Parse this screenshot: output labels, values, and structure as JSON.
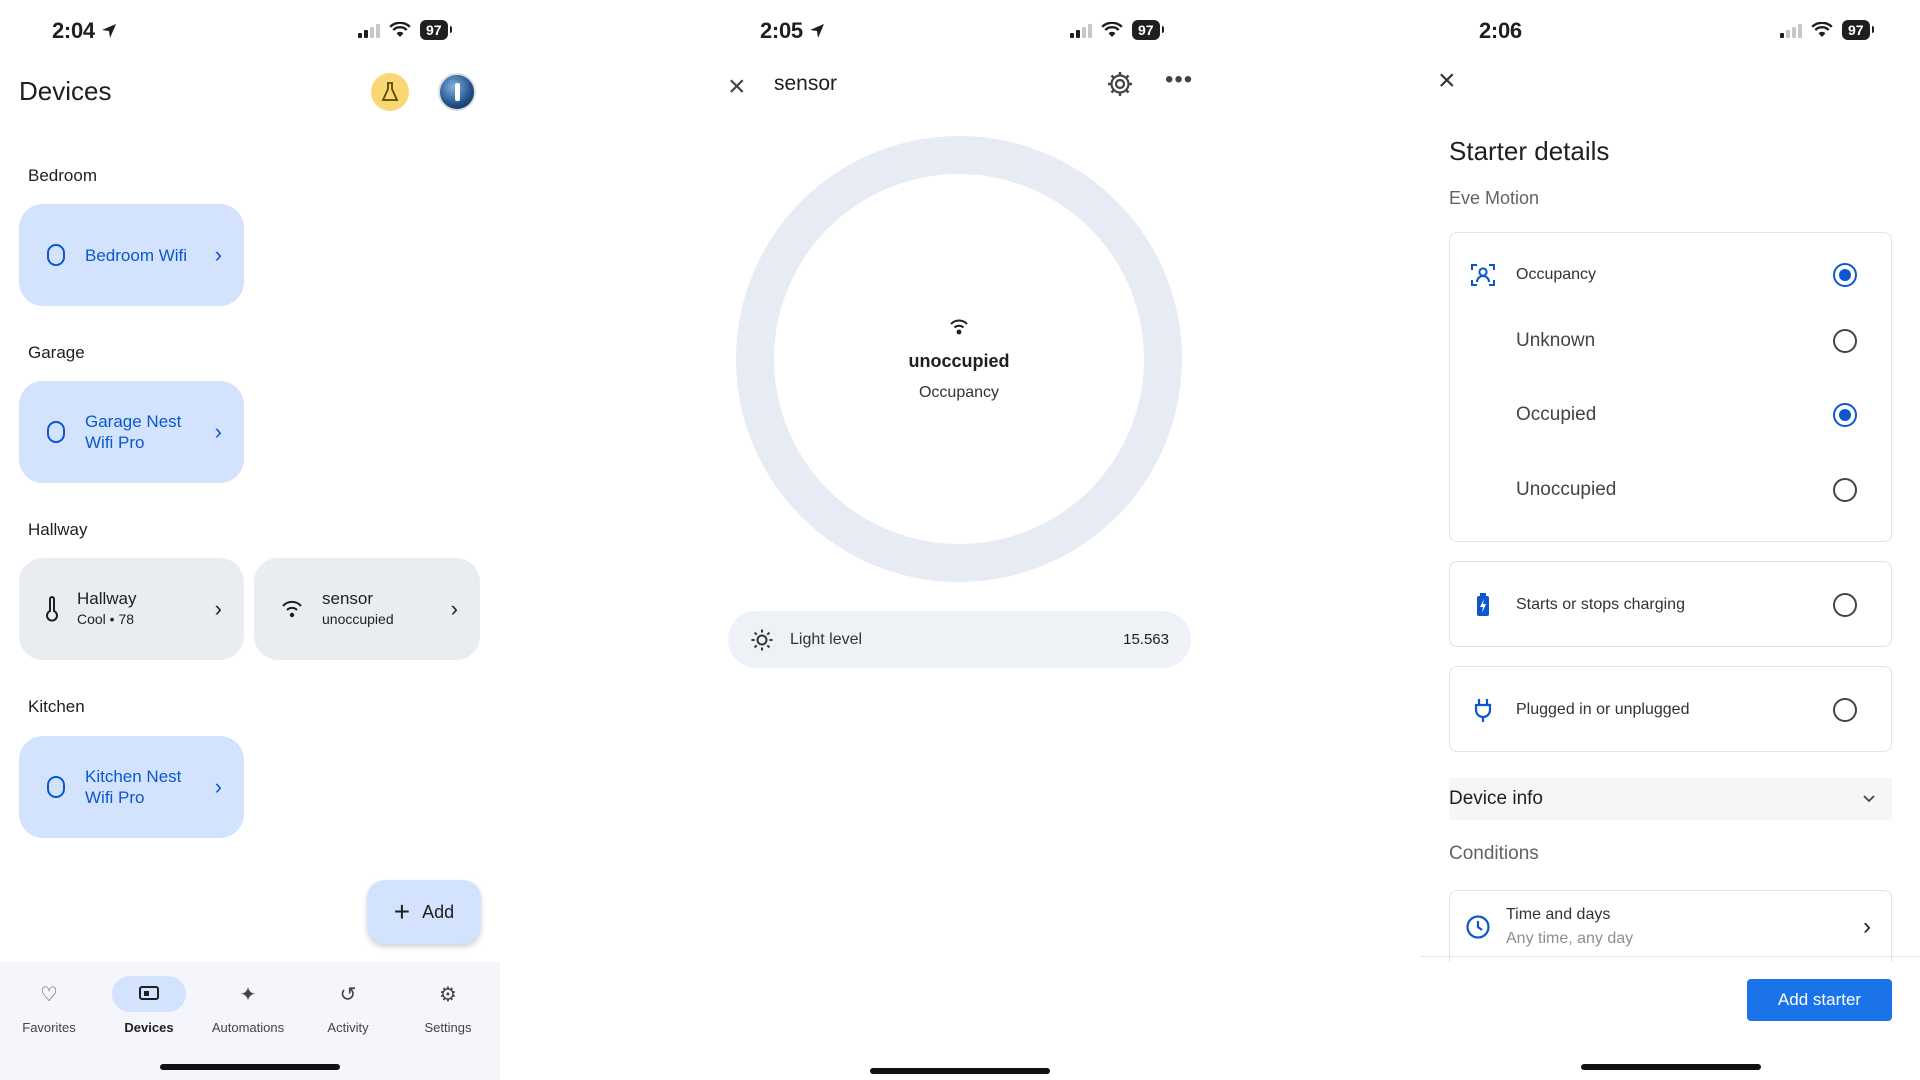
{
  "panel1": {
    "status": {
      "time": "2:04",
      "battery": "97"
    },
    "title": "Devices",
    "rooms": [
      {
        "name": "Bedroom"
      },
      {
        "name": "Garage"
      },
      {
        "name": "Hallway"
      },
      {
        "name": "Kitchen"
      }
    ],
    "tiles": {
      "bedroom_wifi": {
        "line1": "Bedroom Wifi",
        "line2": ""
      },
      "garage_wifi": {
        "line1": "Garage Nest",
        "line2": "Wifi Pro"
      },
      "hallway": {
        "line1": "Hallway",
        "line2": "Cool • 78"
      },
      "sensor": {
        "line1": "sensor",
        "line2": "unoccupied"
      },
      "kitchen_wifi": {
        "line1": "Kitchen Nest",
        "line2": "Wifi Pro"
      }
    },
    "fab_label": "Add",
    "nav": [
      {
        "label": "Favorites",
        "icon": "heart-icon"
      },
      {
        "label": "Devices",
        "icon": "devices-icon"
      },
      {
        "label": "Automations",
        "icon": "sparkle-icon"
      },
      {
        "label": "Activity",
        "icon": "history-icon"
      },
      {
        "label": "Settings",
        "icon": "gear-icon"
      }
    ],
    "active_nav": "Devices"
  },
  "panel2": {
    "status": {
      "time": "2:05",
      "battery": "97"
    },
    "title": "sensor",
    "state": "unoccupied",
    "state_label": "Occupancy",
    "light_label": "Light level",
    "light_value": "15.563"
  },
  "panel3": {
    "status": {
      "time": "2:06",
      "battery": "97"
    },
    "title": "Starter details",
    "subtitle": "Eve Motion",
    "occupancy": {
      "label": "Occupancy",
      "options": [
        {
          "label": "Unknown",
          "selected": false
        },
        {
          "label": "Occupied",
          "selected": true
        },
        {
          "label": "Unoccupied",
          "selected": false
        }
      ]
    },
    "charging_label": "Starts or stops charging",
    "plugged_label": "Plugged in or unplugged",
    "device_info": "Device info",
    "conditions": "Conditions",
    "time_title": "Time and days",
    "time_sub": "Any time, any day",
    "add_button": "Add starter"
  },
  "colors": {
    "accent": "#0b57d0",
    "tile_blue": "#d3e3fd",
    "button_blue": "#1a73e8"
  }
}
